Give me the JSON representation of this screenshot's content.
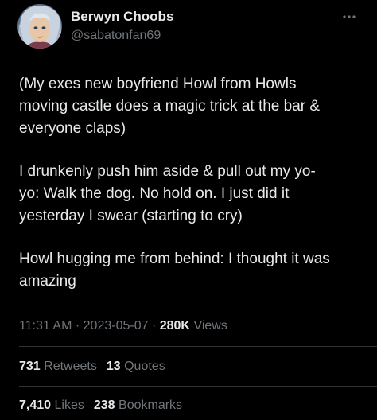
{
  "author": {
    "display_name": "Berwyn Choobs",
    "handle": "@sabatonfan69"
  },
  "tweet": {
    "paragraphs": [
      "(My exes new boyfriend Howl from Howls\nmoving castle does a magic trick at the bar &\neveryone claps)",
      "I drunkenly push him aside & pull out my yo-\nyo: Walk the dog. No hold on. I just did it\nyesterday I swear (starting to cry)",
      "Howl hugging me from behind: I thought it was\namazing"
    ]
  },
  "meta": {
    "time": "11:31 AM",
    "separator": "·",
    "date": "2023-05-07",
    "views_count": "280K",
    "views_label": "Views"
  },
  "stats": {
    "retweets_count": "731",
    "retweets_label": "Retweets",
    "quotes_count": "13",
    "quotes_label": "Quotes",
    "likes_count": "7,410",
    "likes_label": "Likes",
    "bookmarks_count": "238",
    "bookmarks_label": "Bookmarks"
  },
  "colors": {
    "background": "#000000",
    "primary_text": "#e7e9ea",
    "secondary_text": "#71767b",
    "divider": "#2f3336"
  },
  "icons": {
    "more": "more-horizontal-icon",
    "avatar": "avatar"
  }
}
